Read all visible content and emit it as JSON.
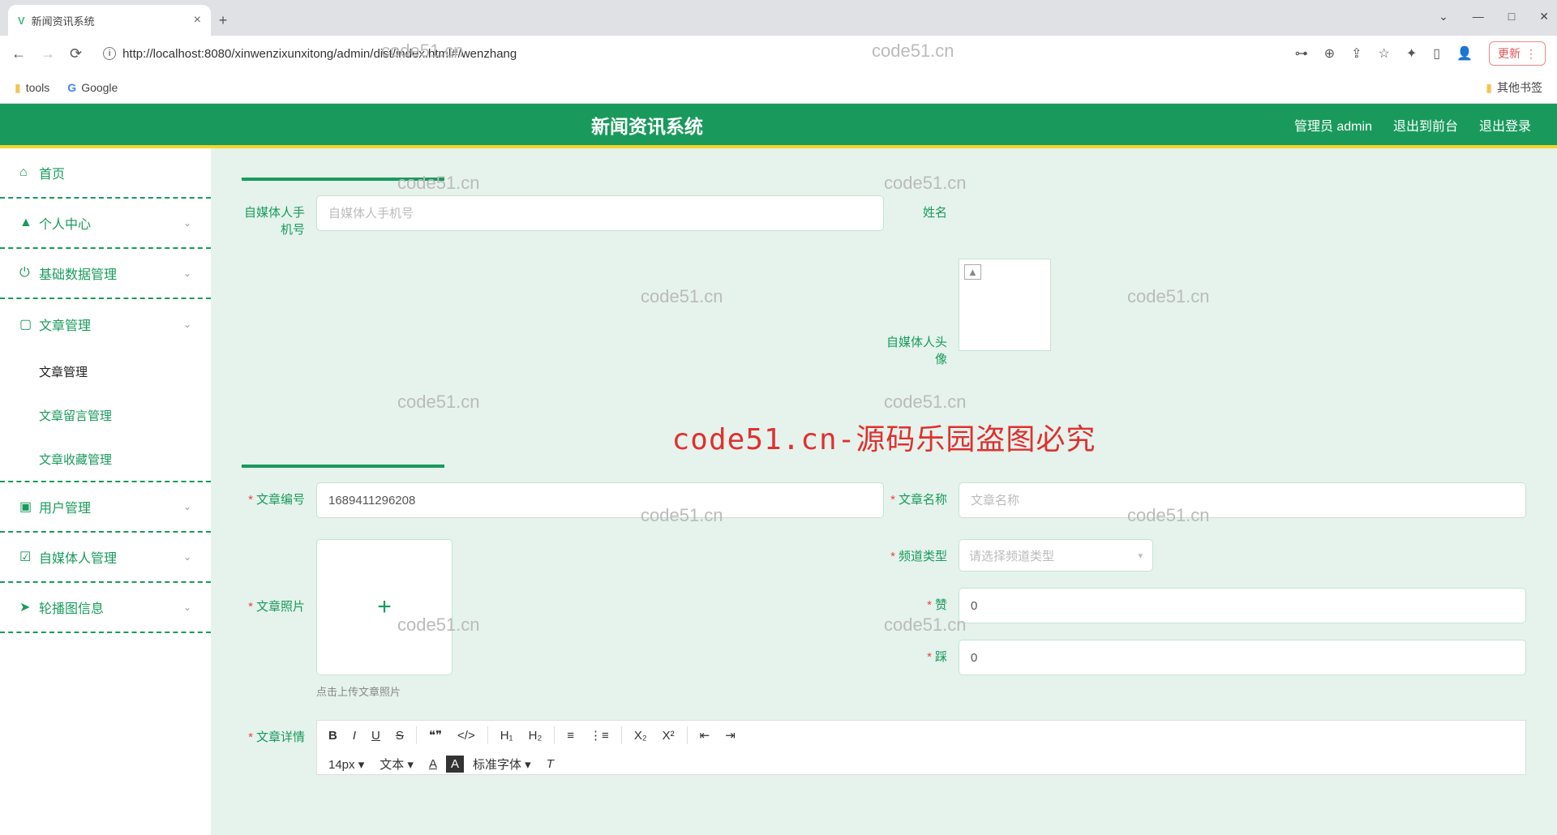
{
  "browser": {
    "tab_title": "新闻资讯系统",
    "url": "http://localhost:8080/xinwenzixunxitong/admin/dist/index.html#/wenzhang",
    "update_btn": "更新",
    "bookmarks": {
      "tools": "tools",
      "google": "Google",
      "other": "其他书签"
    }
  },
  "header": {
    "title": "新闻资讯系统",
    "user": "管理员 admin",
    "exit_front": "退出到前台",
    "logout": "退出登录"
  },
  "sidebar": {
    "home": "首页",
    "personal": "个人中心",
    "basedata": "基础数据管理",
    "article_mgmt": "文章管理",
    "sub_article": "文章管理",
    "sub_comment": "文章留言管理",
    "sub_collect": "文章收藏管理",
    "user_mgmt": "用户管理",
    "media_mgmt": "自媒体人管理",
    "carousel": "轮播图信息"
  },
  "form": {
    "media_phone_label": "自媒体人手机号",
    "media_phone_ph": "自媒体人手机号",
    "name_label": "姓名",
    "media_head_label": "自媒体人头像",
    "article_no_label": "文章编号",
    "article_no_val": "1689411296208",
    "article_name_label": "文章名称",
    "article_name_ph": "文章名称",
    "article_photo_label": "文章照片",
    "upload_hint": "点击上传文章照片",
    "channel_label": "频道类型",
    "channel_ph": "请选择频道类型",
    "like_label": "赞",
    "like_val": "0",
    "dislike_label": "踩",
    "dislike_val": "0",
    "detail_label": "文章详情"
  },
  "editor": {
    "fontsize": "14px",
    "style": "文本",
    "font": "标准字体"
  },
  "watermarks": {
    "wm": "code51.cn",
    "big": "code51.cn-源码乐园盗图必究"
  }
}
